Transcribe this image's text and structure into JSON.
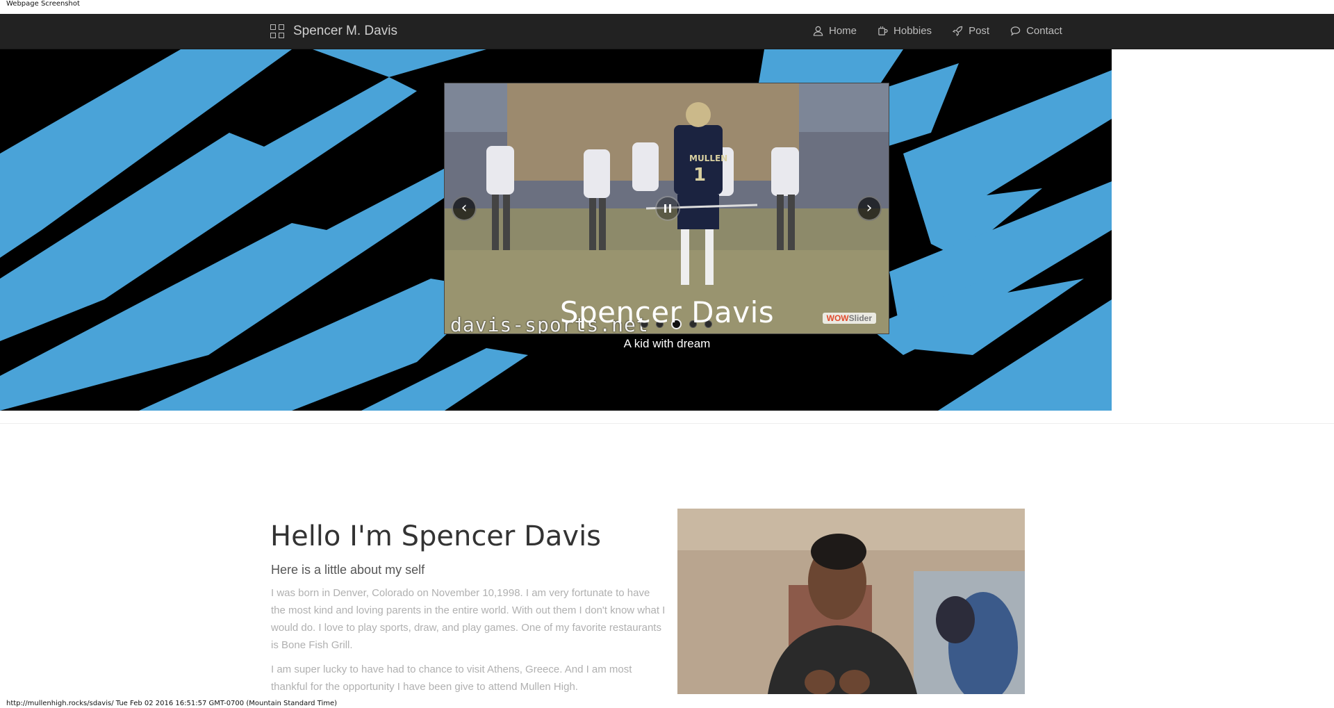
{
  "page_caption": "Webpage Screenshot",
  "navbar": {
    "brand": "Spencer M. Davis",
    "items": [
      {
        "label": "Home",
        "icon": "user-icon"
      },
      {
        "label": "Hobbies",
        "icon": "mug-icon"
      },
      {
        "label": "Post",
        "icon": "rocket-icon"
      },
      {
        "label": "Contact",
        "icon": "speech-bubble-icon"
      }
    ]
  },
  "hero": {
    "title": "Spencer Davis",
    "subtitle": "A kid with dream",
    "colors": {
      "stripe": "#4aa3d8",
      "background": "#000000"
    }
  },
  "slider": {
    "prev": "‹",
    "next": "›",
    "watermark": "davis-sports.net",
    "badge_a": "WOW",
    "badge_b": "Slider",
    "slide_count": 5,
    "active_slide": 3,
    "jersey_number": "1",
    "jersey_text": "MULLEN"
  },
  "about": {
    "title": "Hello I'm Spencer Davis",
    "subtitle": "Here is a little about my self",
    "paragraph1": "I was born in Denver, Colorado on November 10,1998. I am very fortunate to have the most kind and loving parents in the entire world. With out them I don't know what I would do. I love to play sports, draw, and play games. One of my favorite restaurants is Bone Fish Grill.",
    "paragraph2": "I am super lucky to have had to chance to visit Athens, Greece. And I am most thankful for the opportunity I have been give to attend Mullen High."
  },
  "footer_caption": "http://mullenhigh.rocks/sdavis/ Tue Feb 02 2016 16:51:57 GMT-0700 (Mountain Standard Time)"
}
